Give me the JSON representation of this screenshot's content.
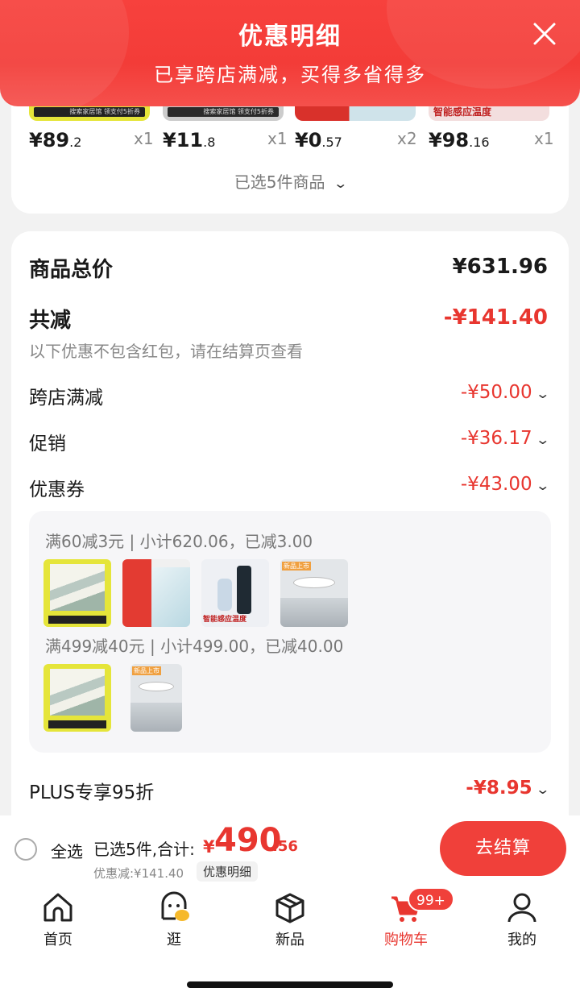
{
  "header": {
    "title": "优惠明细",
    "subtitle": "已享跨店满减，买得多省得多"
  },
  "products": [
    {
      "price_int": "¥89",
      "price_dec": ".2",
      "qty": "x1"
    },
    {
      "price_int": "¥11",
      "price_dec": ".8",
      "qty": "x1"
    },
    {
      "price_int": "¥0",
      "price_dec": ".57",
      "qty": "x2"
    },
    {
      "price_int": "¥98",
      "price_dec": ".16",
      "qty": "x1"
    }
  ],
  "product_strip_texts": [
    "搜索家居馆 领支付5折券",
    "搜索家居馆 领支付5折券",
    "智能感应温度"
  ],
  "selected_summary": "已选5件商品",
  "breakdown": {
    "total_label": "商品总价",
    "total_value": "¥631.96",
    "reduce_label": "共减",
    "reduce_value": "-¥141.40",
    "note": "以下优惠不包含红包，请在结算页查看",
    "rows": [
      {
        "label": "跨店满减",
        "value": "-¥50.00"
      },
      {
        "label": "促销",
        "value": "-¥36.17"
      },
      {
        "label": "优惠券",
        "value": "-¥43.00"
      }
    ],
    "plus_label": "PLUS专享95折",
    "plus_value": "-¥8.95"
  },
  "coupon_detail": {
    "line1": "满60减3元 | 小计620.06，已减3.00",
    "line2": "满499减40元 | 小计499.00，已减40.00",
    "img_texts": [
      "智能感应温度",
      "新品上市",
      "新品上市"
    ]
  },
  "bottom": {
    "select_all": "全选",
    "selected_total_label": "已选5件,合计:",
    "currency": "¥",
    "amount_int": "490",
    "amount_dec": ".56",
    "discount_label": "优惠减:¥141.40",
    "detail_button": "优惠明细",
    "checkout": "去结算"
  },
  "tabs": [
    {
      "label": "首页",
      "icon": "home-icon"
    },
    {
      "label": "逛",
      "icon": "browse-icon"
    },
    {
      "label": "新品",
      "icon": "box-icon"
    },
    {
      "label": "购物车",
      "icon": "cart-icon",
      "active": true
    },
    {
      "label": "我的",
      "icon": "user-icon"
    }
  ],
  "cart_badge": "99+",
  "colors": {
    "brand_red": "#f0403a",
    "discount_red": "#e8362f"
  }
}
